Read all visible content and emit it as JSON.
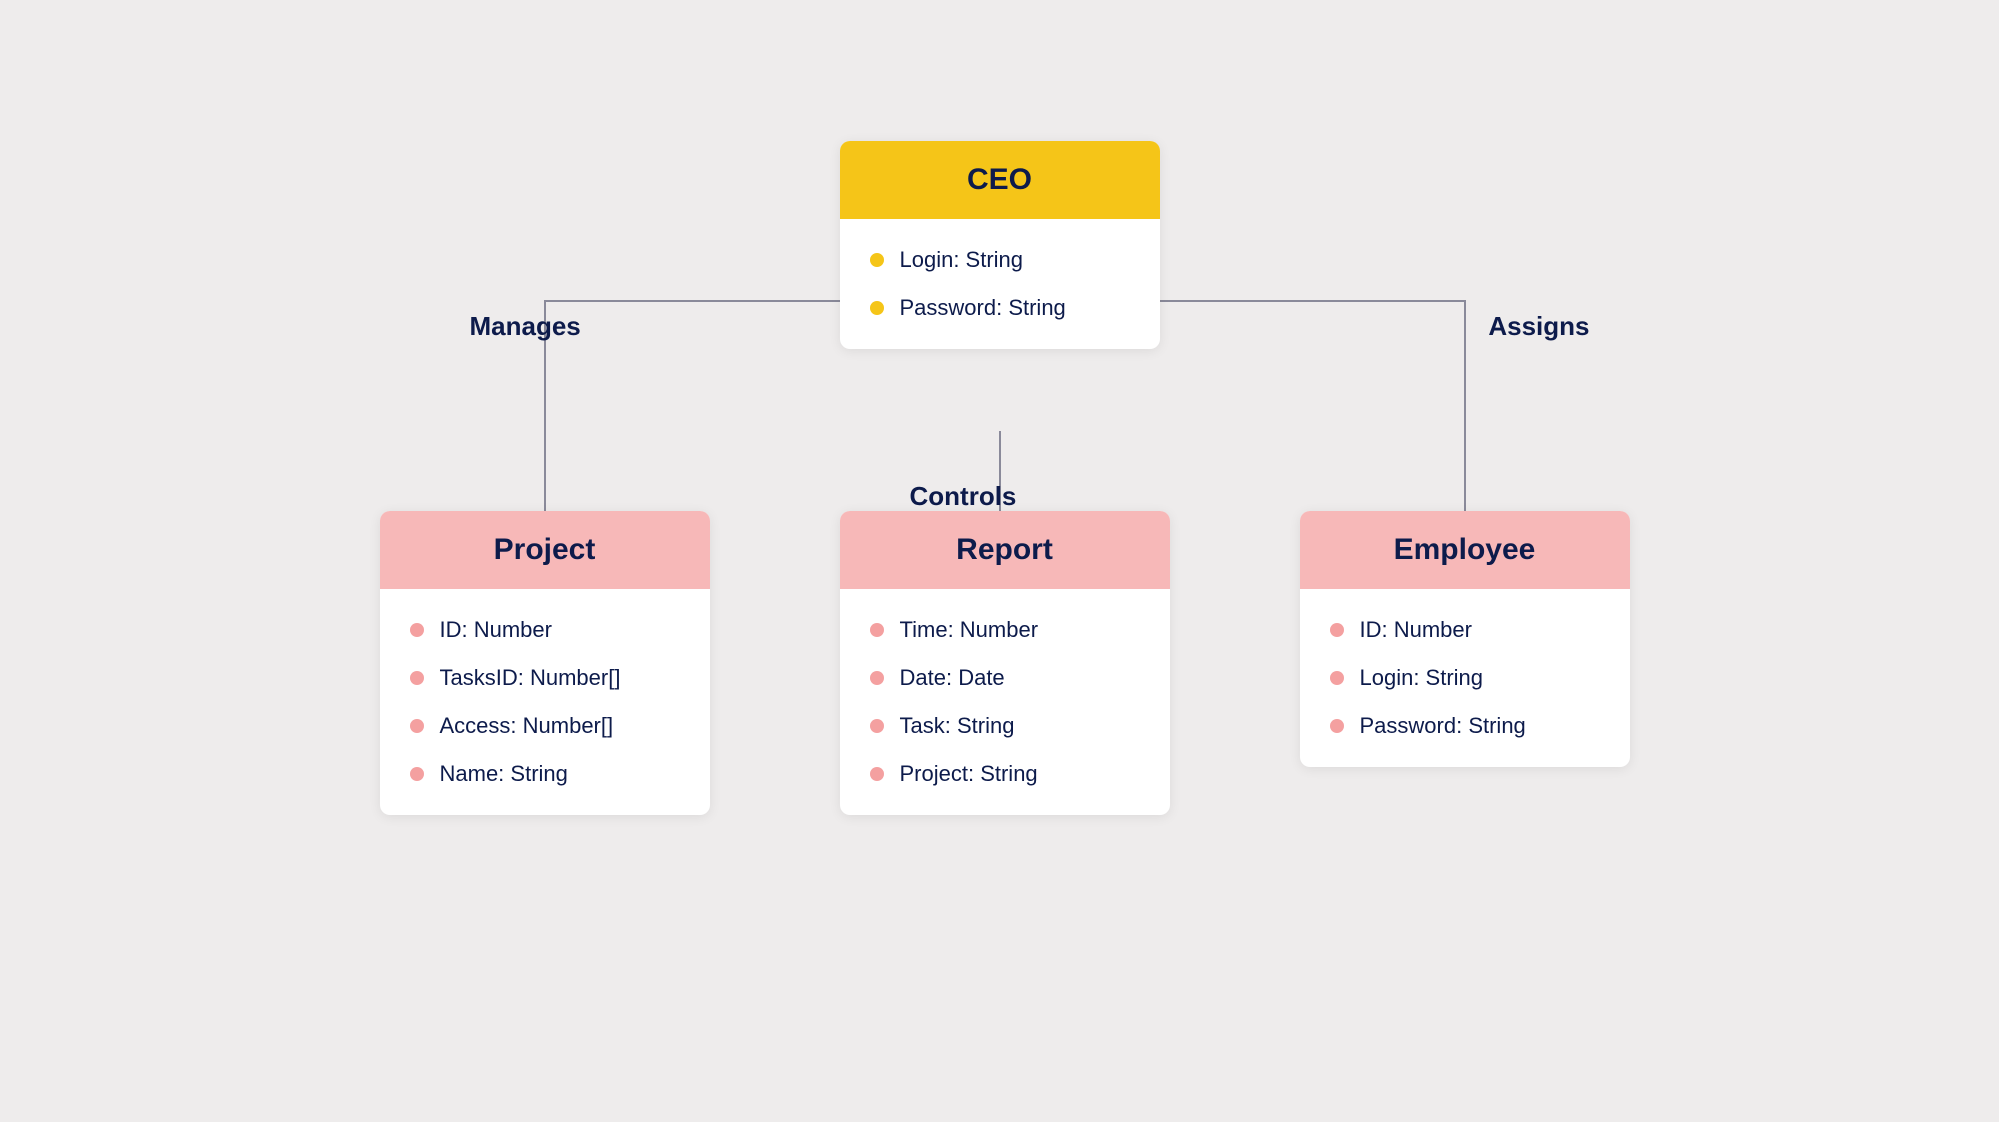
{
  "ceo": {
    "title": "CEO",
    "fields": [
      {
        "name": "Login: String"
      },
      {
        "name": "Password: String"
      }
    ]
  },
  "project": {
    "title": "Project",
    "fields": [
      {
        "name": "ID: Number"
      },
      {
        "name": "TasksID: Number[]"
      },
      {
        "name": "Access: Number[]"
      },
      {
        "name": "Name: String"
      }
    ]
  },
  "report": {
    "title": "Report",
    "fields": [
      {
        "name": "Time: Number"
      },
      {
        "name": "Date: Date"
      },
      {
        "name": "Task: String"
      },
      {
        "name": "Project: String"
      }
    ]
  },
  "employee": {
    "title": "Employee",
    "fields": [
      {
        "name": "ID: Number"
      },
      {
        "name": "Login: String"
      },
      {
        "name": "Password: String"
      }
    ]
  },
  "relationships": {
    "manages": "Manages",
    "controls": "Controls",
    "assigns": "Assigns"
  }
}
